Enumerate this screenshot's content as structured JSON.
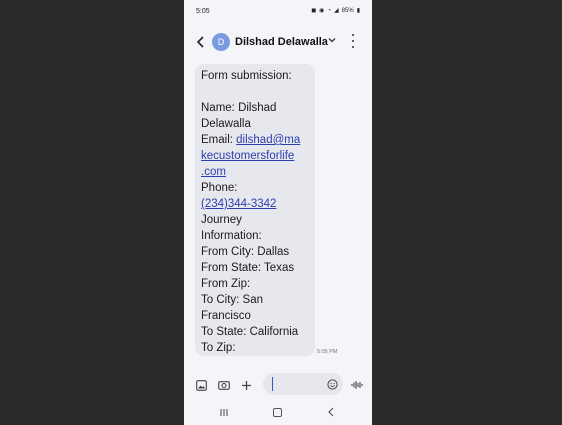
{
  "status": {
    "time": "5:05",
    "battery": "85%"
  },
  "header": {
    "avatar_letter": "D",
    "contact_name": "Dilshad Delawalla"
  },
  "message": {
    "lines": [
      "Form submission:",
      "",
      "Name: Dilshad",
      "Delawalla",
      "Email: ",
      "kecustomersforlife",
      ".com",
      "Phone:",
      "(234)344-3342",
      "Journey",
      "Information:",
      "From City: Dallas",
      "From State: Texas",
      "From Zip:",
      "To City: San",
      "Francisco",
      "To State: California",
      "To Zip:"
    ],
    "email_link_part1": "dilshad@ma",
    "timestamp": "5:05 PM"
  },
  "icons": {
    "back": "back-arrow-icon",
    "chevron": "chevron-down-icon",
    "more": "more-vert-icon",
    "gallery": "image-icon",
    "camera": "camera-icon",
    "add": "plus-icon",
    "emoji": "emoji-icon",
    "voice": "voice-wave-icon",
    "nav_recents": "recents-icon",
    "nav_home": "home-icon",
    "nav_back": "nav-back-icon"
  },
  "colors": {
    "avatar": "#7b9be0",
    "link": "#2a3fae",
    "bubble": "#e7e8ee",
    "screen_bg": "#f4f5f9"
  }
}
